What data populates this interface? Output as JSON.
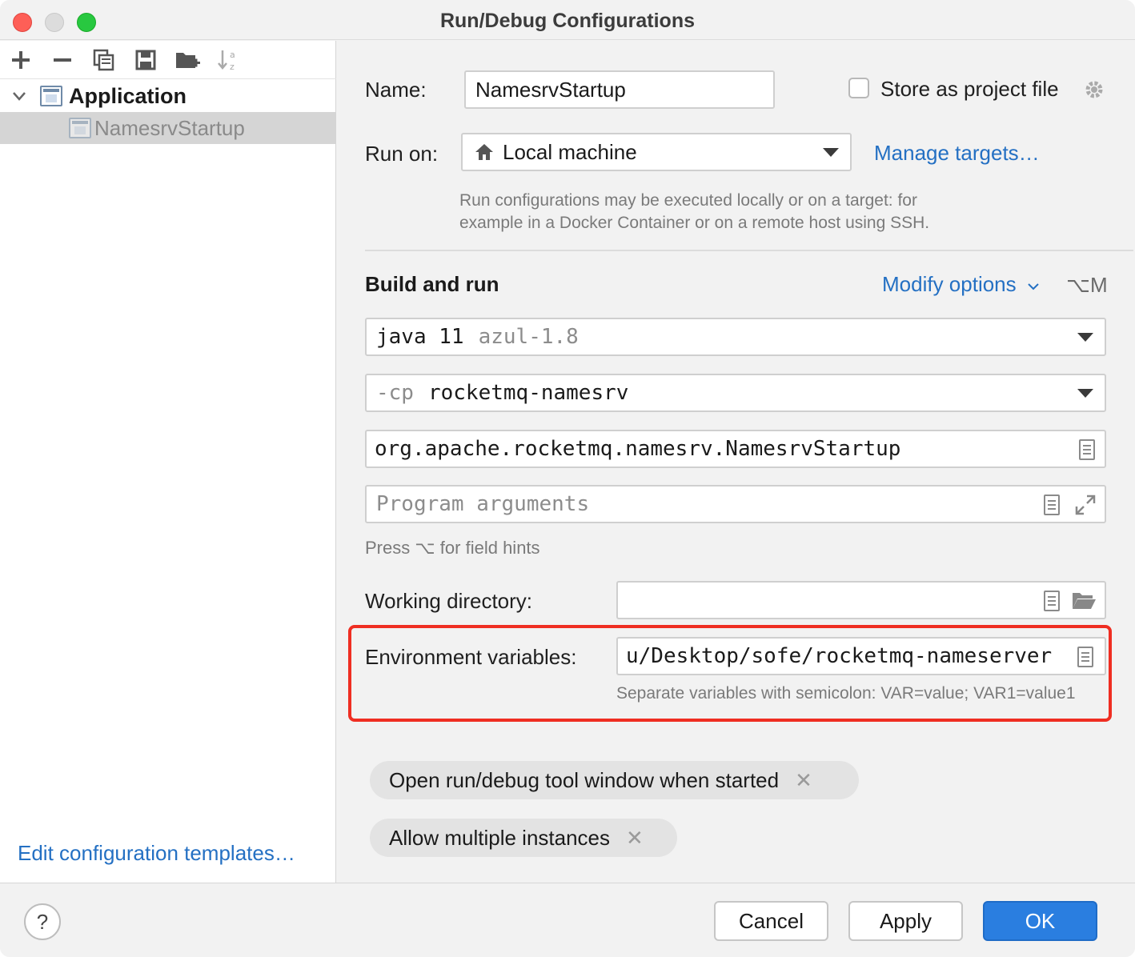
{
  "window": {
    "title": "Run/Debug Configurations"
  },
  "sidebar": {
    "tree": {
      "group_label": "Application",
      "items": [
        {
          "label": "NamesrvStartup"
        }
      ]
    },
    "edit_templates_link": "Edit configuration templates…"
  },
  "config": {
    "name_label": "Name:",
    "name_value": "NamesrvStartup",
    "store_as_project_label": "Store as project file",
    "run_on_label": "Run on:",
    "run_on_value": "Local machine",
    "manage_targets_link": "Manage targets…",
    "run_on_hint_line1": "Run configurations may be executed locally or on a target: for",
    "run_on_hint_line2": "example in a Docker Container or on a remote host using SSH.",
    "section_title": "Build and run",
    "modify_options_link": "Modify options",
    "modify_options_shortcut": "⌥M",
    "jdk_value": "java 11",
    "jdk_hint": "azul-1.8",
    "cp_prefix": "-cp",
    "cp_value": "rocketmq-namesrv",
    "main_class_value": "org.apache.rocketmq.namesrv.NamesrvStartup",
    "program_args_placeholder": "Program arguments",
    "field_hints_text": "Press ⌥ for field hints",
    "working_dir_label": "Working directory:",
    "working_dir_value": "",
    "env_vars_label": "Environment variables:",
    "env_vars_value": "u/Desktop/sofe/rocketmq-nameserver",
    "env_vars_hint": "Separate variables with semicolon: VAR=value; VAR1=value1",
    "chips": [
      {
        "label": "Open run/debug tool window when started"
      },
      {
        "label": "Allow multiple instances"
      }
    ]
  },
  "footer": {
    "help_label": "?",
    "cancel_label": "Cancel",
    "apply_label": "Apply",
    "ok_label": "OK"
  },
  "colors": {
    "accent": "#2470c3",
    "primary_button": "#2a7ee0",
    "highlight": "#ef2e22"
  }
}
